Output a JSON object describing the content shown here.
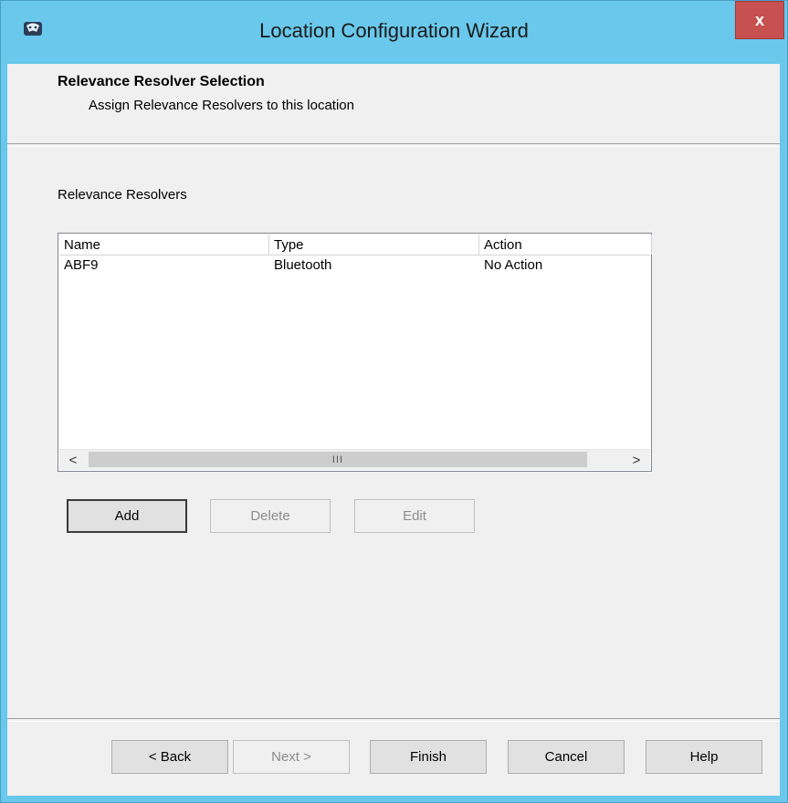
{
  "window": {
    "title": "Location Configuration Wizard",
    "app_icon": "app-logo-icon",
    "close_label": "x"
  },
  "header": {
    "title": "Relevance Resolver Selection",
    "subtitle": "Assign Relevance Resolvers to this location"
  },
  "resolvers": {
    "label": "Relevance Resolvers",
    "columns": [
      "Name",
      "Type",
      "Action"
    ],
    "rows": [
      {
        "name": "ABF9",
        "type": "Bluetooth",
        "action": "No Action"
      }
    ],
    "scroll_left": "<",
    "scroll_right": ">",
    "thumb_grip": "III"
  },
  "list_buttons": {
    "add": "Add",
    "delete": "Delete",
    "edit": "Edit"
  },
  "footer_buttons": {
    "back": "< Back",
    "next": "Next >",
    "finish": "Finish",
    "cancel": "Cancel",
    "help": "Help"
  },
  "colors": {
    "titlebar": "#69c8ec",
    "close": "#c75050",
    "dialog": "#f0f0f0"
  }
}
